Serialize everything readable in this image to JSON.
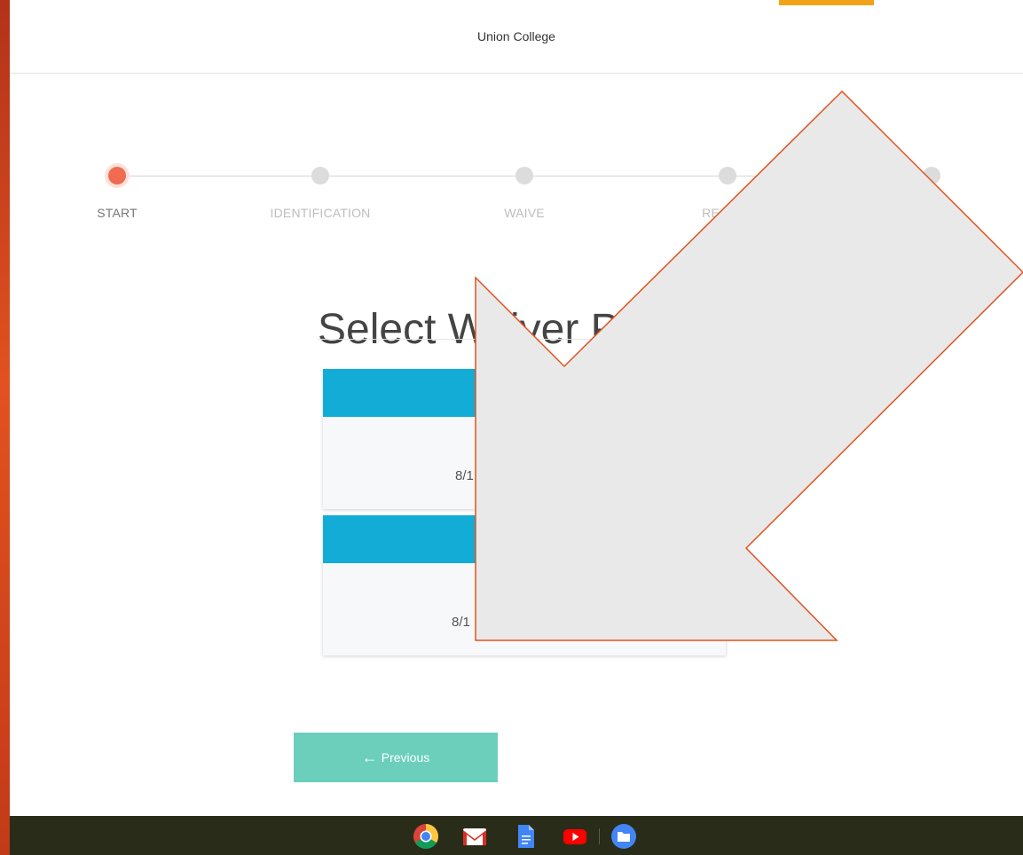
{
  "header": {
    "title": "Union College"
  },
  "stepper": {
    "steps": [
      {
        "label": "START",
        "active": true
      },
      {
        "label": "IDENTIFICATION",
        "active": false
      },
      {
        "label": "WAIVE",
        "active": false
      },
      {
        "label": "RE",
        "active": false
      },
      {
        "label": "",
        "active": false
      }
    ]
  },
  "main": {
    "title": "Select Waiver P",
    "cards": [
      {
        "date": "8/1"
      },
      {
        "date": "8/1"
      }
    ]
  },
  "footer": {
    "previous_label": "Previous",
    "previous_icon": "arrow-left-icon"
  },
  "shelf": {
    "apps": [
      "chrome-icon",
      "gmail-icon",
      "docs-icon",
      "youtube-icon",
      "files-icon"
    ]
  },
  "colors": {
    "accent": "#f06b4f",
    "card_header": "#12acd7",
    "button": "#6bcfbc",
    "overlay_fill": "#e9e9e9",
    "overlay_stroke": "#e0531f"
  }
}
